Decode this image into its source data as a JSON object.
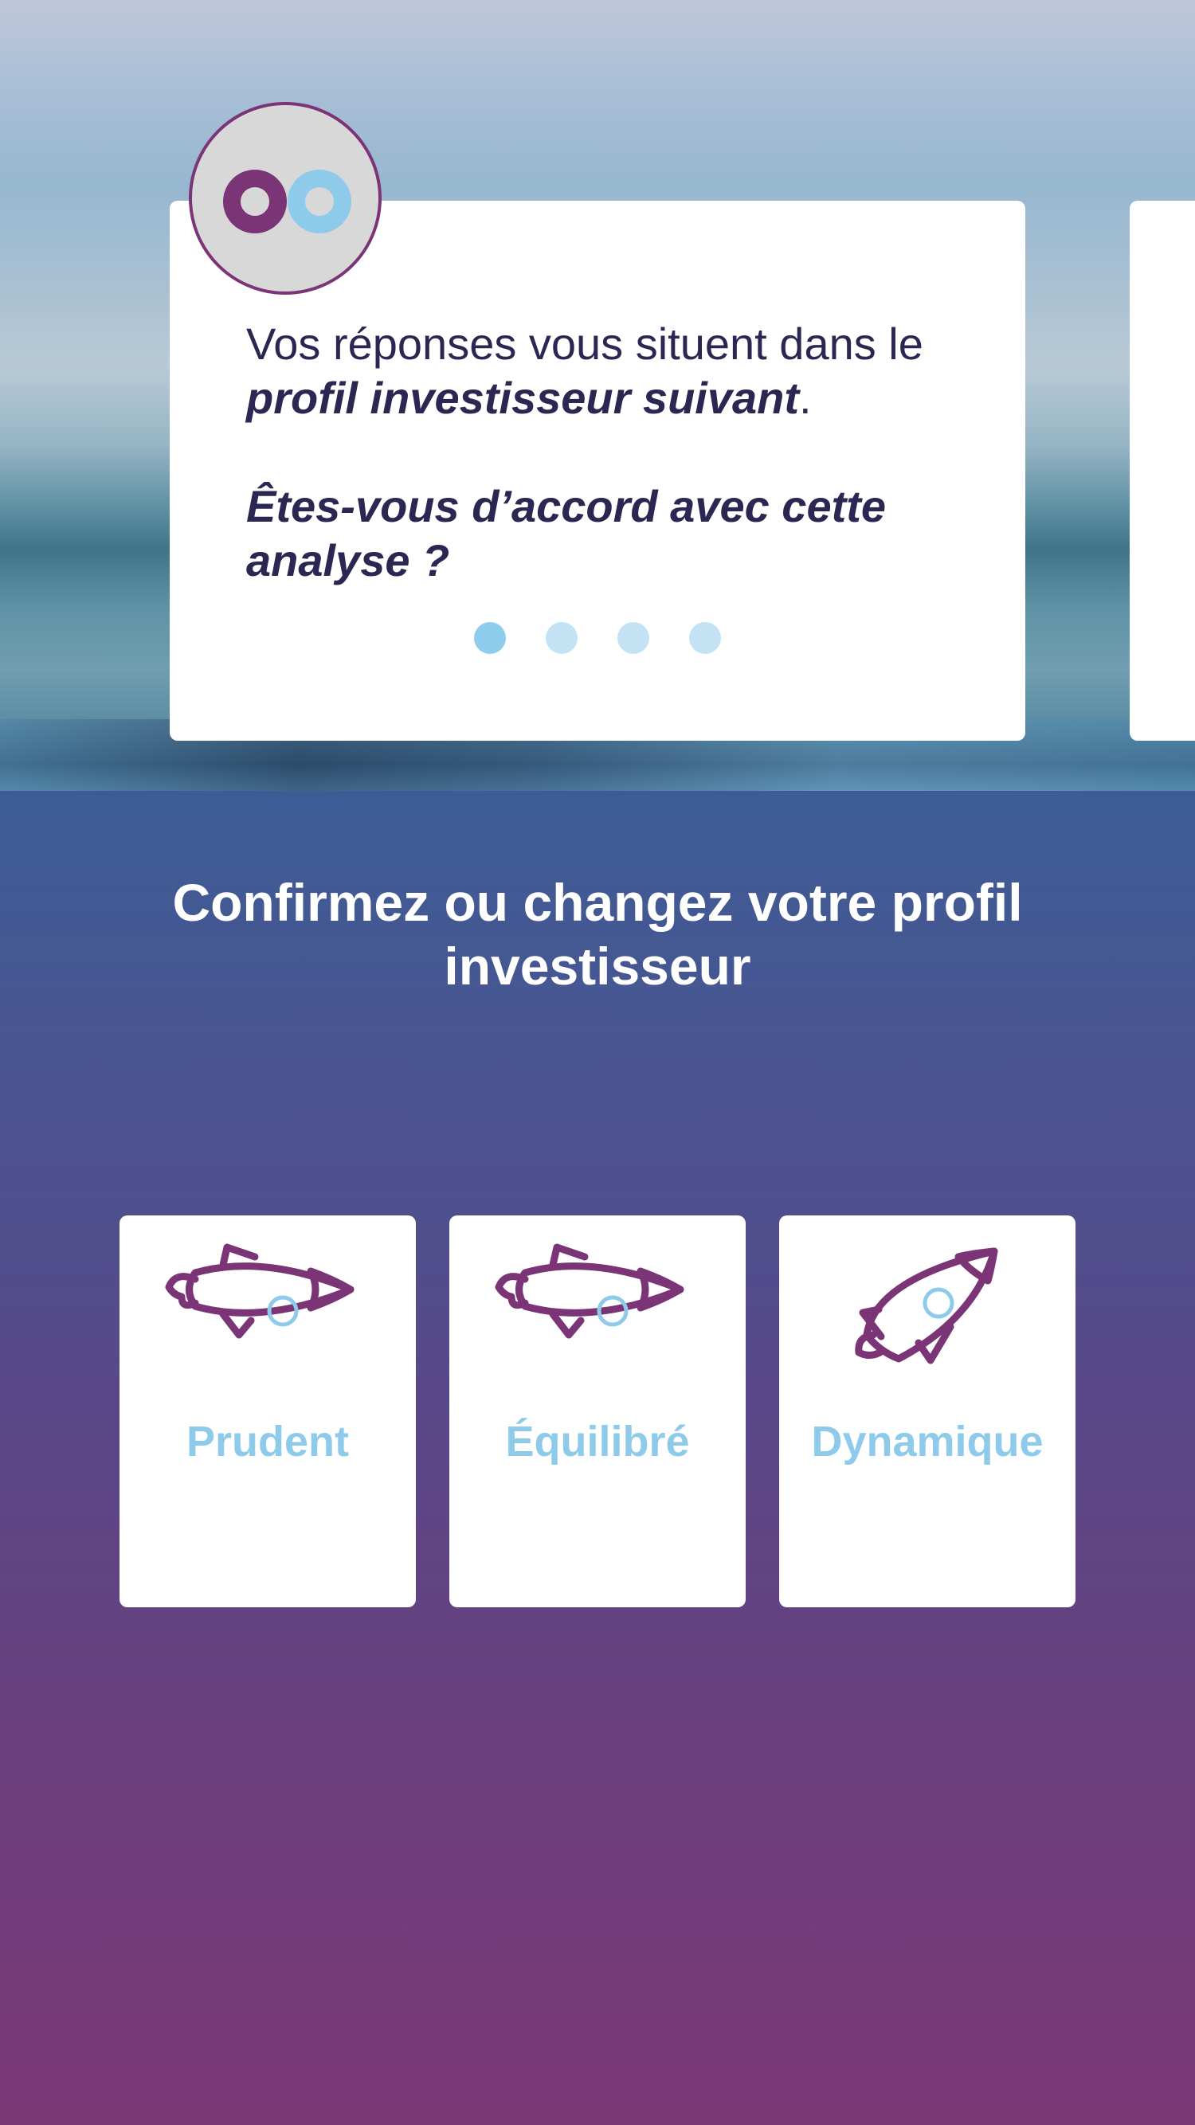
{
  "hero": {
    "avatar_logo": "oo",
    "message_line1": "Vos réponses vous situent dans le",
    "message_bold": "profil investisseur suivant",
    "message_punct": ".",
    "question_line1": "Êtes-vous d’accord avec cette",
    "question_line2": "analyse ?",
    "carousel_dots": 4,
    "active_dot": 1
  },
  "section": {
    "title_line1": "Confirmez ou changez votre profil",
    "title_line2": "investisseur"
  },
  "profiles": [
    {
      "label": "Prudent",
      "icon": "rocket-icon"
    },
    {
      "label": "Équilibré",
      "icon": "rocket-icon"
    },
    {
      "label": "Dynamique",
      "icon": "rocket-icon"
    }
  ],
  "colors": {
    "purple": "#7b3577",
    "light_blue": "#8ecaea",
    "text_dark": "#2a2752"
  }
}
